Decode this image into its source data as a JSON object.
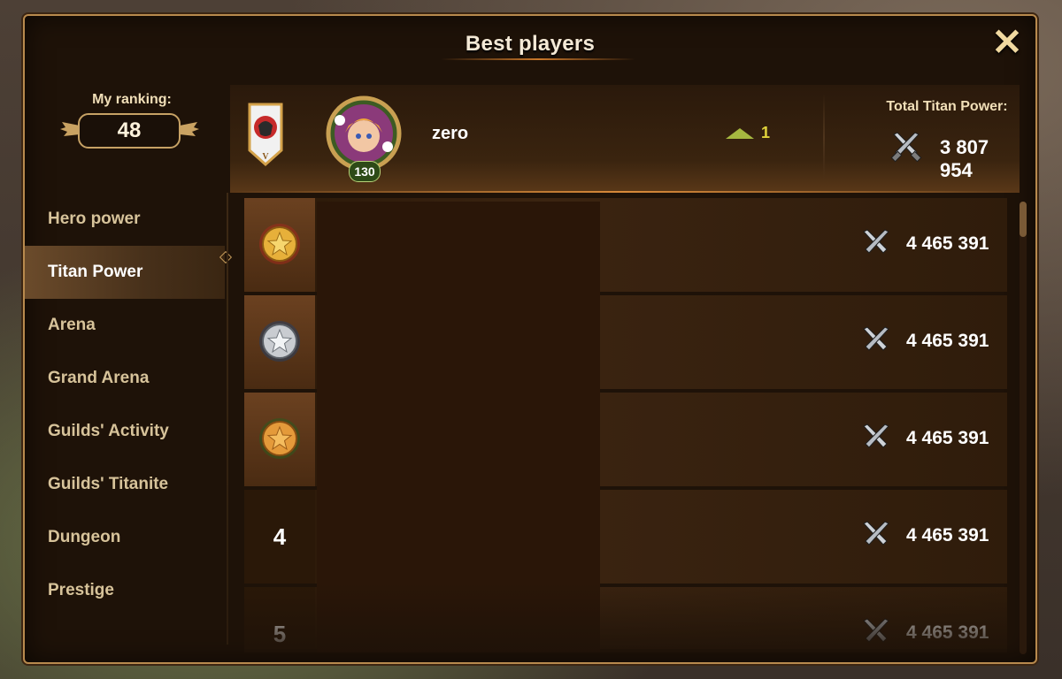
{
  "title": "Best players",
  "close_glyph": "✕",
  "sidebar": {
    "my_ranking_label": "My ranking:",
    "my_ranking_value": "48",
    "items": [
      {
        "label": "Hero power",
        "active": false
      },
      {
        "label": "Titan Power",
        "active": true
      },
      {
        "label": "Arena",
        "active": false
      },
      {
        "label": "Grand Arena",
        "active": false
      },
      {
        "label": "Guilds' Activity",
        "active": false
      },
      {
        "label": "Guilds' Titanite",
        "active": false
      },
      {
        "label": "Dungeon",
        "active": false
      },
      {
        "label": "Prestige",
        "active": false
      }
    ]
  },
  "me": {
    "name": "zero",
    "level": "130",
    "rank_change": "1",
    "total_label": "Total Titan Power:",
    "total_value": "3 807 954"
  },
  "rows": [
    {
      "rank": "1",
      "medal": "gold",
      "value": "4 465 391"
    },
    {
      "rank": "2",
      "medal": "silver",
      "value": "4 465 391"
    },
    {
      "rank": "3",
      "medal": "bronze",
      "value": "4 465 391"
    },
    {
      "rank": "4",
      "medal": null,
      "value": "4 465 391"
    },
    {
      "rank": "5",
      "medal": null,
      "value": "4 465 391"
    }
  ],
  "colors": {
    "gold": "#e7b03a",
    "silver": "#c9ccd1",
    "bronze": "#e49a3a",
    "accent": "#b88a4e"
  }
}
